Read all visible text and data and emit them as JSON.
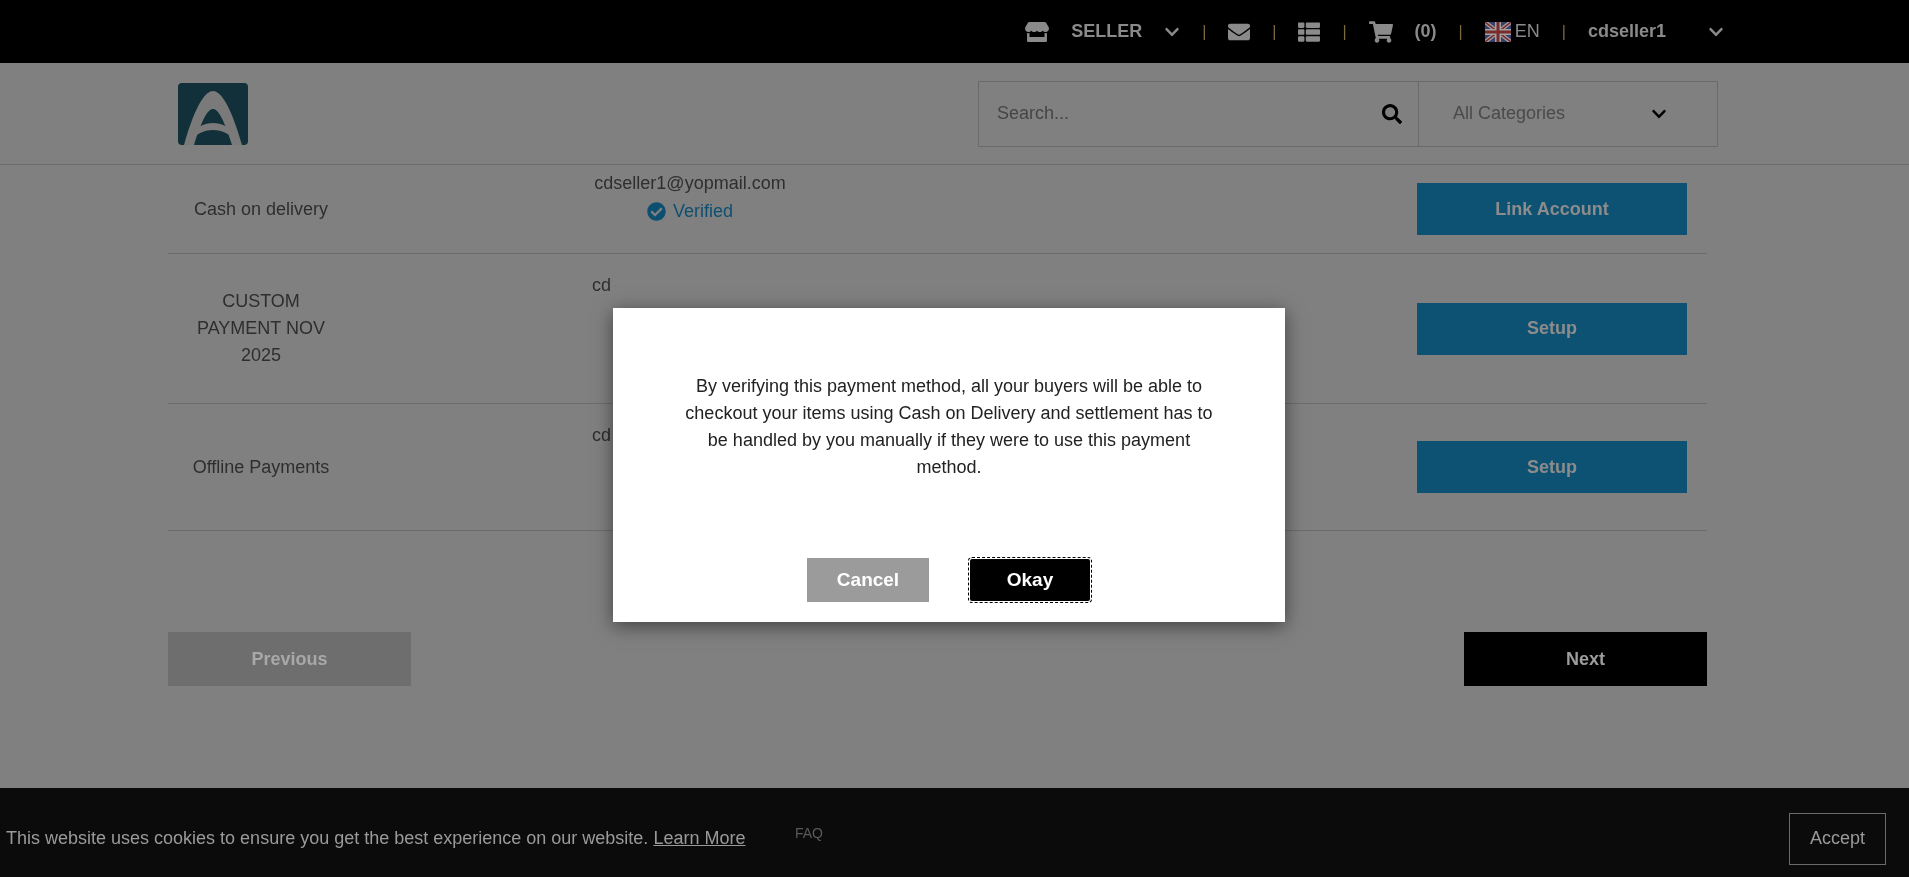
{
  "top_bar": {
    "role": "SELLER",
    "separators": [
      "|",
      "|",
      "|",
      "|",
      "|"
    ],
    "cart_count": "(0)",
    "language": "EN",
    "username": "cdseller1"
  },
  "header": {
    "search": {
      "placeholder": "Search..."
    },
    "category": "All Categories"
  },
  "payment_methods": [
    {
      "name": "Cash on delivery",
      "email": "cdseller1@yopmail.com",
      "verified": true,
      "status": "Verified",
      "action": "Link Account"
    },
    {
      "name": "CUSTOM PAYMENT NOV 2025",
      "email": "cd",
      "action": "Setup"
    },
    {
      "name": "Offline Payments",
      "email": "cd",
      "action": "Setup"
    }
  ],
  "nav": {
    "previous": {
      "label": "Previous",
      "disabled": true
    },
    "next": {
      "label": "Next",
      "disabled": false
    }
  },
  "footer": {
    "links": [
      "FAQ"
    ]
  },
  "dialog": {
    "message": "By verifying this payment method, all your buyers will be able to checkout your items using Cash on Delivery and settlement has to be handled by you manually if they were to use this payment method.",
    "buttons": [
      {
        "label": "Cancel",
        "kind": "secondary"
      },
      {
        "label": "Okay",
        "kind": "primary"
      }
    ]
  },
  "cookie_banner": {
    "message": "This website uses cookies to ensure you get the best experience on our website.",
    "link": "Learn More",
    "button": "Accept"
  }
}
